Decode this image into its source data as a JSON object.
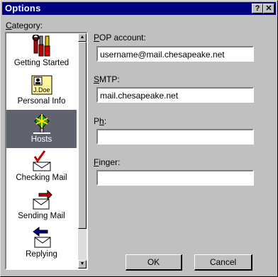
{
  "window": {
    "title": "Options",
    "help_label": "?",
    "close_label": "✕"
  },
  "category": {
    "label_u": "C",
    "label_rest": "ategory:",
    "items": [
      {
        "label": "Getting Started",
        "icon": "tools-icon",
        "selected": false
      },
      {
        "label": "Personal Info",
        "icon": "id-card-icon",
        "selected": false
      },
      {
        "label": "Hosts",
        "icon": "hosts-network-icon",
        "selected": true
      },
      {
        "label": "Checking Mail",
        "icon": "check-mail-icon",
        "selected": false
      },
      {
        "label": "Sending Mail",
        "icon": "send-mail-icon",
        "selected": false
      },
      {
        "label": "Replying",
        "icon": "reply-mail-icon",
        "selected": false
      }
    ]
  },
  "fields": {
    "pop": {
      "label_u": "P",
      "label_rest": "OP account:",
      "value": "username@mail.chesapeake.net"
    },
    "smtp": {
      "label_u": "S",
      "label_rest": "MTP:",
      "value": "mail.chesapeake.net"
    },
    "ph": {
      "label_pre": "P",
      "label_u": "h",
      "label_rest": ":",
      "value": ""
    },
    "finger": {
      "label_u": "F",
      "label_rest": "inger:",
      "value": ""
    }
  },
  "buttons": {
    "ok": "OK",
    "cancel": "Cancel"
  },
  "icon_text": {
    "jdoe": "J.Doe"
  },
  "colors": {
    "titlebar": "#000080",
    "selected": "#5f6370",
    "face": "#c0c0c0"
  }
}
